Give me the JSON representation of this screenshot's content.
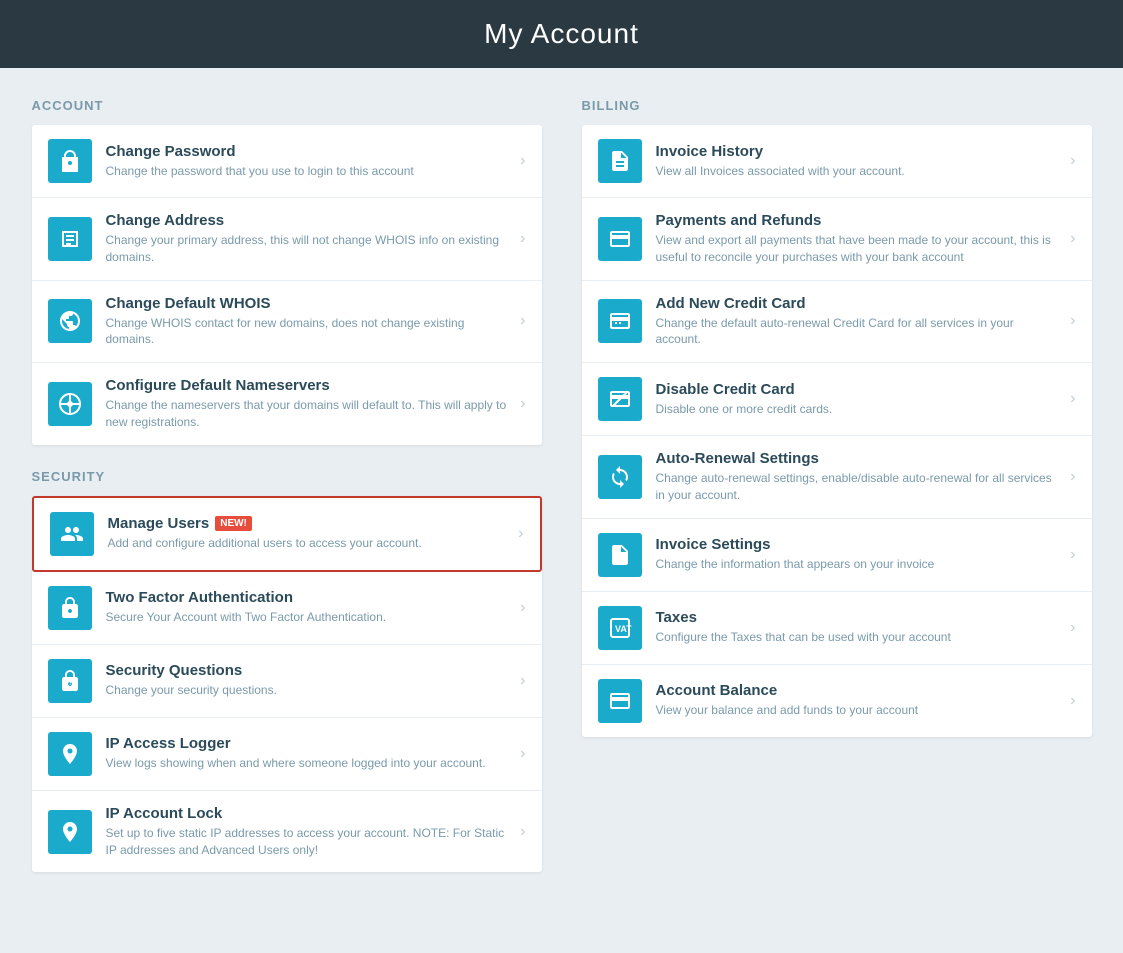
{
  "header": {
    "title": "My Account"
  },
  "account_section": {
    "label": "ACCOUNT",
    "items": [
      {
        "id": "change-password",
        "title": "Change Password",
        "desc": "Change the password that you use to login to this account",
        "icon": "key"
      },
      {
        "id": "change-address",
        "title": "Change Address",
        "desc": "Change your primary address, this will not change WHOIS info on existing domains.",
        "icon": "address"
      },
      {
        "id": "change-whois",
        "title": "Change Default WHOIS",
        "desc": "Change WHOIS contact for new domains, does not change existing domains.",
        "icon": "globe"
      },
      {
        "id": "configure-nameservers",
        "title": "Configure Default Nameservers",
        "desc": "Change the nameservers that your domains will default to. This will apply to new registrations.",
        "icon": "nameserver"
      }
    ]
  },
  "security_section": {
    "label": "SECURITY",
    "items": [
      {
        "id": "manage-users",
        "title": "Manage Users",
        "desc": "Add and configure additional users to access your account.",
        "icon": "users",
        "badge": "New!",
        "highlighted": true
      },
      {
        "id": "two-factor",
        "title": "Two Factor Authentication",
        "desc": "Secure Your Account with Two Factor Authentication.",
        "icon": "lock"
      },
      {
        "id": "security-questions",
        "title": "Security Questions",
        "desc": "Change your security questions.",
        "icon": "lock2"
      },
      {
        "id": "ip-access-logger",
        "title": "IP Access Logger",
        "desc": "View logs showing when and where someone logged into your account.",
        "icon": "pin"
      },
      {
        "id": "ip-account-lock",
        "title": "IP Account Lock",
        "desc": "Set up to five static IP addresses to access your account. NOTE: For Static IP addresses and Advanced Users only!",
        "icon": "pin2"
      }
    ]
  },
  "billing_section": {
    "label": "BILLING",
    "items": [
      {
        "id": "invoice-history",
        "title": "Invoice History",
        "desc": "View all Invoices associated with your account.",
        "icon": "invoice"
      },
      {
        "id": "payments-refunds",
        "title": "Payments and Refunds",
        "desc": "View and export all payments that have been made to your account, this is useful to reconcile your purchases with your bank account",
        "icon": "payments"
      },
      {
        "id": "add-credit-card",
        "title": "Add New Credit Card",
        "desc": "Change the default auto-renewal Credit Card for all services in your account.",
        "icon": "creditcard"
      },
      {
        "id": "disable-credit-card",
        "title": "Disable Credit Card",
        "desc": "Disable one or more credit cards.",
        "icon": "disable-card"
      },
      {
        "id": "auto-renewal",
        "title": "Auto-Renewal Settings",
        "desc": "Change auto-renewal settings, enable/disable auto-renewal for all services in your account.",
        "icon": "renewal"
      },
      {
        "id": "invoice-settings",
        "title": "Invoice Settings",
        "desc": "Change the information that appears on your invoice",
        "icon": "invoice-settings"
      },
      {
        "id": "taxes",
        "title": "Taxes",
        "desc": "Configure the Taxes that can be used with your account",
        "icon": "tax"
      },
      {
        "id": "account-balance",
        "title": "Account Balance",
        "desc": "View your balance and add funds to your account",
        "icon": "balance"
      }
    ]
  },
  "colors": {
    "icon_bg": "#1aabcc",
    "header_bg": "#2b3a42",
    "new_badge": "#e74c3c",
    "highlight_border": "#c0392b"
  }
}
